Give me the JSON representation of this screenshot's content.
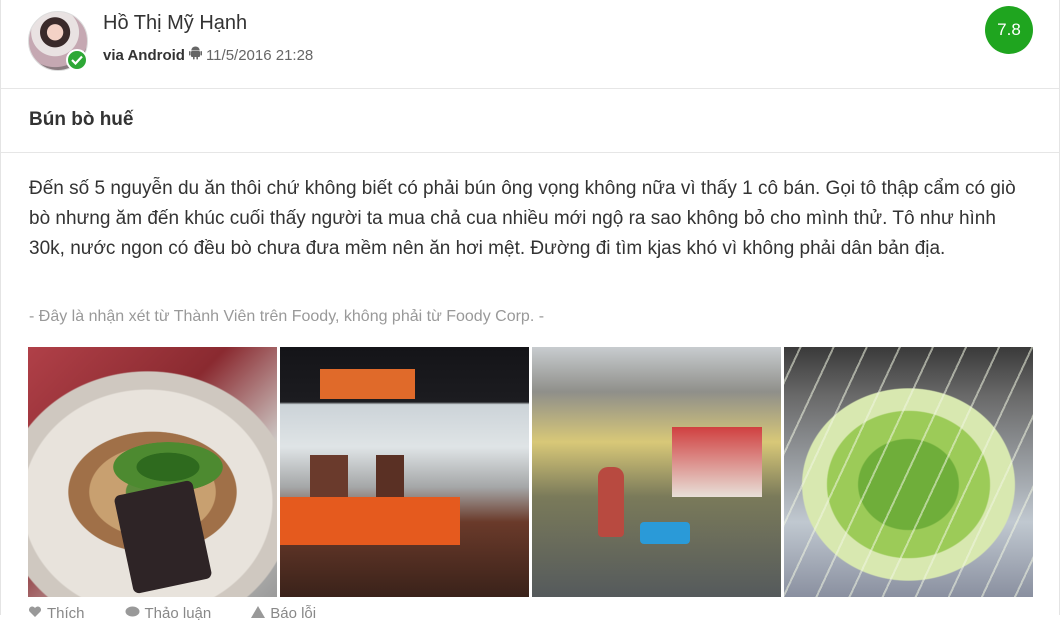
{
  "user": {
    "name": "Hồ Thị Mỹ Hạnh",
    "via": "via Android",
    "platform_icon": "android-icon",
    "timestamp": "11/5/2016 21:28"
  },
  "score": "7.8",
  "review": {
    "title": "Bún bò huế",
    "body": "Đến số 5 nguyễn du ăn thôi chứ không biết có phải bún ông vọng không nữa vì thấy 1 cô bán. Gọi tô thập cẩm có giò bò nhưng ăm đến khúc cuối thấy người ta mua chả cua nhiều mới ngộ ra sao không bỏ cho mình thử. Tô như hình 30k, nước ngon có đều bò chưa đưa mềm nên ăn hơi mệt. Đường đi tìm kjas khó vì không phải dân bản địa.",
    "disclaimer": "- Đây là nhận xét từ Thành Viên trên Foody, không phải từ Foody Corp. -"
  },
  "actions": {
    "like": "Thích",
    "discuss": "Thảo luận",
    "report": "Báo lỗi"
  },
  "colors": {
    "score_bg": "#1fa51f",
    "verified": "#2ea836"
  }
}
